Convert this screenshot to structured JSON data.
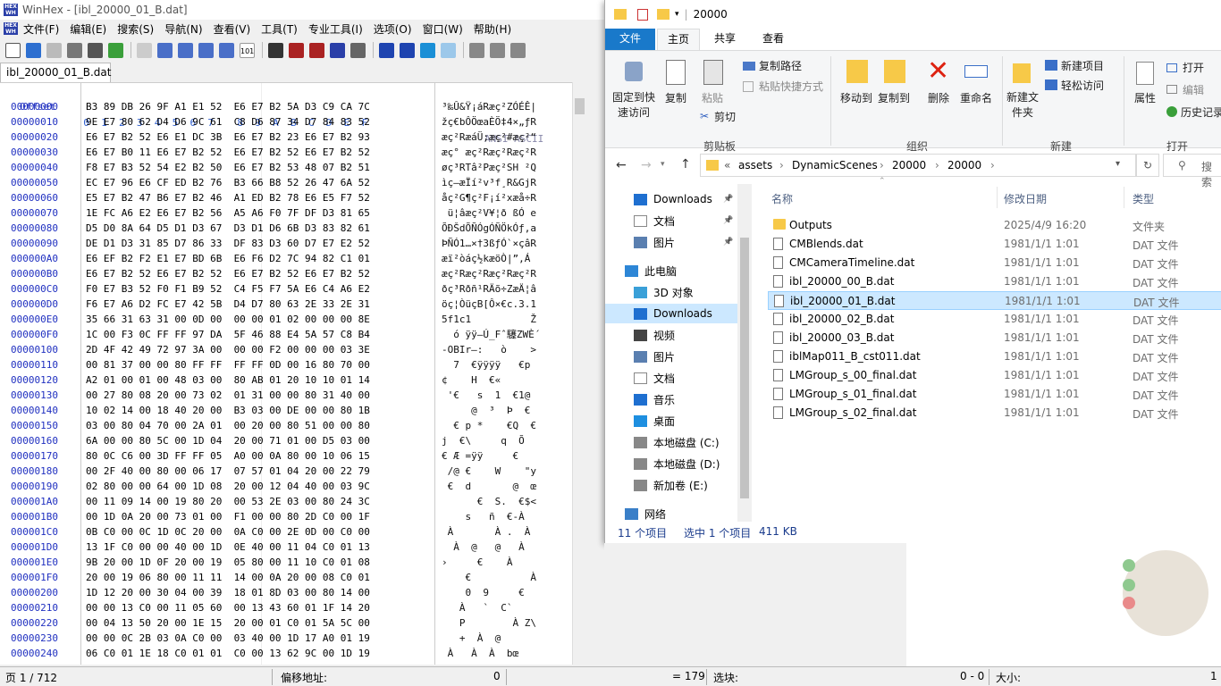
{
  "winhex": {
    "title": "WinHex - [ibl_20000_01_B.dat]",
    "menu": [
      "文件(F)",
      "编辑(E)",
      "搜索(S)",
      "导航(N)",
      "查看(V)",
      "工具(T)",
      "专业工具(I)",
      "选项(O)",
      "窗口(W)",
      "帮助(H)"
    ],
    "tab": "ibl_20000_01_B.dat",
    "header": {
      "offset": "Offset",
      "cols": "  0  1  2  3  4  5  6  7    8  9  A  B  C  D  E  F",
      "ansi": "ANSI ASCII"
    },
    "rows": [
      {
        "o": "00000000",
        "b": "B3 89 DB 26 9F A1 E1 52  E6 E7 B2 5A D3 C9 CA 7C",
        "a": "³‰Û&Ÿ¡áRæç²ZÓÉÊ|"
      },
      {
        "o": "00000010",
        "b": "9E E7 80 62 D4 D6 9C 61  C8 D6 87 34 D7 84 83 52",
        "a": "žç€bÔÖœaÈÖ‡4×„ƒR"
      },
      {
        "o": "00000020",
        "b": "E6 E7 B2 52 E6 E1 DC 3B  E6 E7 B2 23 E6 E7 B2 93",
        "a": "æç²RæáÜ;æç²#æç²“"
      },
      {
        "o": "00000030",
        "b": "E6 E7 B0 11 E6 E7 B2 52  E6 E7 B2 52 E6 E7 B2 52",
        "a": "æç° æç²Ræç²Ræç²R"
      },
      {
        "o": "00000040",
        "b": "F8 E7 B3 52 54 E2 B2 50  E6 E7 B2 53 48 07 B2 51",
        "a": "øç³RTâ²Pæç²SH ²Q"
      },
      {
        "o": "00000050",
        "b": "EC E7 96 E6 CF ED B2 76  B3 66 B8 52 26 47 6A 52",
        "a": "ìç–æÏí²v³f¸R&GjR"
      },
      {
        "o": "00000060",
        "b": "E5 E7 B2 47 B6 E7 B2 46  A1 ED B2 78 E6 E5 F7 52",
        "a": "åç²G¶ç²F¡í²xæå÷R"
      },
      {
        "o": "00000070",
        "b": "1E FC A6 E2 E6 E7 B2 56  A5 A6 F0 7F DF D3 81 65",
        "a": " ü¦âæç²V¥¦ð ßÓ e"
      },
      {
        "o": "00000080",
        "b": "D5 D0 8A 64 D5 D1 D3 67  D3 D1 D6 6B D3 83 82 61",
        "a": "ÕÐŠdÕÑÓgÓÑÖkÓƒ‚a"
      },
      {
        "o": "00000090",
        "b": "DE D1 D3 31 85 D7 86 33  DF 83 D3 60 D7 E7 E2 52",
        "a": "ÞÑÓ1…×†3ßƒÓ`×çâR"
      },
      {
        "o": "000000A0",
        "b": "E6 EF B2 F2 E1 E7 BD 6B  E6 F6 D2 7C 94 82 C1 01",
        "a": "æï²òáç½kæöÒ|”‚Á "
      },
      {
        "o": "000000B0",
        "b": "E6 E7 B2 52 E6 E7 B2 52  E6 E7 B2 52 E6 E7 B2 52",
        "a": "æç²Ræç²Ræç²Ræç²R"
      },
      {
        "o": "000000C0",
        "b": "F0 E7 B3 52 F0 F1 B9 52  C4 F5 F7 5A E6 C4 A6 E2",
        "a": "ðç³Rðñ¹RÄõ÷ZæÄ¦â"
      },
      {
        "o": "000000D0",
        "b": "F6 E7 A6 D2 FC E7 42 5B  D4 D7 80 63 2E 33 2E 31",
        "a": "öç¦ÒüçB[Ô×€c.3.1"
      },
      {
        "o": "000000E0",
        "b": "35 66 31 63 31 00 0D 00  00 00 01 02 00 00 00 8E",
        "a": "5f1c1          Ž"
      },
      {
        "o": "000000F0",
        "b": "1C 00 F3 0C FF FF 97 DA  5F 46 88 E4 5A 57 C8 B4",
        "a": "  ó ÿÿ—Ú_Fˆ䮿ZWÈ´"
      },
      {
        "o": "00000100",
        "b": "2D 4F 42 49 72 97 3A 00  00 00 F2 00 00 00 03 3E",
        "a": "-OBIr—:   ò    >"
      },
      {
        "o": "00000110",
        "b": "00 81 37 00 00 80 FF FF  FF FF 0D 00 16 80 70 00",
        "a": "  7  €ÿÿÿÿ   €p "
      },
      {
        "o": "00000120",
        "b": "A2 01 00 01 00 48 03 00  80 AB 01 20 10 10 01 14",
        "a": "¢    H  €«      "
      },
      {
        "o": "00000130",
        "b": "00 27 80 08 20 00 73 02  01 31 00 00 80 31 40 00",
        "a": " '€   s  1  €1@ "
      },
      {
        "o": "00000140",
        "b": "10 02 14 00 18 40 20 00  B3 03 00 DE 00 00 80 1B",
        "a": "     @  ³  Þ  € "
      },
      {
        "o": "00000150",
        "b": "03 00 80 04 70 00 2A 01  00 20 00 80 51 00 00 80",
        "a": "  € p *    €Q  €"
      },
      {
        "o": "00000160",
        "b": "6A 00 00 80 5C 00 1D 04  20 00 71 01 00 D5 03 00",
        "a": "j  €\\     q  Õ  "
      },
      {
        "o": "00000170",
        "b": "80 0C C6 00 3D FF FF 05  A0 00 0A 80 00 10 06 15",
        "a": "€ Æ =ÿÿ     €    "
      },
      {
        "o": "00000180",
        "b": "00 2F 40 00 80 00 06 17  07 57 01 04 20 00 22 79",
        "a": " /@ €    W    \"y"
      },
      {
        "o": "00000190",
        "b": "02 80 00 00 64 00 1D 08  20 00 12 04 40 00 03 9C",
        "a": " €  d       @  œ"
      },
      {
        "o": "000001A0",
        "b": "00 11 09 14 00 19 80 20  00 53 2E 03 00 80 24 3C",
        "a": "      €  S.  €$<"
      },
      {
        "o": "000001B0",
        "b": "00 1D 0A 20 00 73 01 00  F1 00 00 80 2D C0 00 1F",
        "a": "    s   ñ  €-À  "
      },
      {
        "o": "000001C0",
        "b": "0B C0 00 0C 1D 0C 20 00  0A C0 00 2E 0D 00 C0 00",
        "a": " À       À .  À "
      },
      {
        "o": "000001D0",
        "b": "13 1F C0 00 00 40 00 1D  0E 40 00 11 04 C0 01 13",
        "a": "  À  @   @   À  "
      },
      {
        "o": "000001E0",
        "b": "9B 20 00 1D 0F 20 00 19  05 80 00 11 10 C0 01 08",
        "a": "›     €    À    "
      },
      {
        "o": "000001F0",
        "b": "20 00 19 06 80 00 11 11  14 00 0A 20 00 08 C0 01",
        "a": "    €          À "
      },
      {
        "o": "00000200",
        "b": "1D 12 20 00 30 04 00 39  18 01 8D 03 00 80 14 00",
        "a": "    0  9     €  "
      },
      {
        "o": "00000210",
        "b": "00 00 13 C0 00 11 05 60  00 13 43 60 01 1F 14 20",
        "a": "   À   `  C`    "
      },
      {
        "o": "00000220",
        "b": "00 04 13 50 20 00 1E 15  20 00 01 C0 01 5A 5C 00",
        "a": "   P        À Z\\ "
      },
      {
        "o": "00000230",
        "b": "00 00 0C 2B 03 0A C0 00  03 40 00 1D 17 A0 01 19",
        "a": "   +  À  @       "
      },
      {
        "o": "00000240",
        "b": "06 C0 01 1E 18 C0 01 01  C0 00 13 62 9C 00 1D 19",
        "a": " À   À  À  bœ   "
      }
    ],
    "status": {
      "page": "页 1 / 712",
      "offset_label": "偏移地址:",
      "offset_val": "0",
      "eq": "= 179",
      "sel_label": "选块:",
      "sel_val": "0 - 0",
      "size_label": "大小:",
      "size_val": "1"
    }
  },
  "explorer": {
    "title": "20000",
    "tabs": [
      "文件",
      "主页",
      "共享",
      "查看"
    ],
    "ribbon": {
      "pin": "固定到快速访问",
      "copy": "复制",
      "paste": "粘贴",
      "copy_path": "复制路径",
      "paste_shortcut": "粘贴快捷方式",
      "cut": "剪切",
      "move_to": "移动到",
      "copy_to": "复制到",
      "delete": "删除",
      "rename": "重命名",
      "new_folder": "新建文件夹",
      "new_item": "新建项目",
      "easy_access": "轻松访问",
      "properties": "属性",
      "open": "打开",
      "edit": "编辑",
      "history": "历史记录",
      "groups": [
        "剪贴板",
        "组织",
        "新建",
        "打开"
      ]
    },
    "path": [
      "«",
      "assets",
      "DynamicScenes",
      "20000",
      "20000"
    ],
    "search": "搜索",
    "nav": [
      {
        "label": "Downloads",
        "icon": "download-icon",
        "pin": true
      },
      {
        "label": "文档",
        "icon": "document-icon",
        "pin": true
      },
      {
        "label": "图片",
        "icon": "picture-icon",
        "pin": true
      },
      {
        "label": "此电脑",
        "icon": "computer-icon"
      },
      {
        "label": "3D 对象",
        "icon": "cube-icon"
      },
      {
        "label": "Downloads",
        "icon": "download-icon",
        "selected": true
      },
      {
        "label": "视频",
        "icon": "video-icon"
      },
      {
        "label": "图片",
        "icon": "picture-icon"
      },
      {
        "label": "文档",
        "icon": "document-icon"
      },
      {
        "label": "音乐",
        "icon": "music-icon"
      },
      {
        "label": "桌面",
        "icon": "desktop-icon"
      },
      {
        "label": "本地磁盘 (C:)",
        "icon": "drive-icon"
      },
      {
        "label": "本地磁盘 (D:)",
        "icon": "drive-icon"
      },
      {
        "label": "新加卷 (E:)",
        "icon": "drive-icon"
      },
      {
        "label": "网络",
        "icon": "network-icon"
      }
    ],
    "columns": {
      "name": "名称",
      "date": "修改日期",
      "type": "类型"
    },
    "files": [
      {
        "name": "Outputs",
        "date": "2025/4/9 16:20",
        "type": "文件夹",
        "folder": true
      },
      {
        "name": "CMBlends.dat",
        "date": "1981/1/1 1:01",
        "type": "DAT 文件"
      },
      {
        "name": "CMCameraTimeline.dat",
        "date": "1981/1/1 1:01",
        "type": "DAT 文件"
      },
      {
        "name": "ibl_20000_00_B.dat",
        "date": "1981/1/1 1:01",
        "type": "DAT 文件"
      },
      {
        "name": "ibl_20000_01_B.dat",
        "date": "1981/1/1 1:01",
        "type": "DAT 文件",
        "selected": true
      },
      {
        "name": "ibl_20000_02_B.dat",
        "date": "1981/1/1 1:01",
        "type": "DAT 文件"
      },
      {
        "name": "ibl_20000_03_B.dat",
        "date": "1981/1/1 1:01",
        "type": "DAT 文件"
      },
      {
        "name": "iblMap011_B_cst011.dat",
        "date": "1981/1/1 1:01",
        "type": "DAT 文件"
      },
      {
        "name": "LMGroup_s_00_final.dat",
        "date": "1981/1/1 1:01",
        "type": "DAT 文件"
      },
      {
        "name": "LMGroup_s_01_final.dat",
        "date": "1981/1/1 1:01",
        "type": "DAT 文件"
      },
      {
        "name": "LMGroup_s_02_final.dat",
        "date": "1981/1/1 1:01",
        "type": "DAT 文件"
      }
    ],
    "status": {
      "count": "11 个项目",
      "selected": "选中 1 个项目",
      "size": "411 KB"
    }
  }
}
